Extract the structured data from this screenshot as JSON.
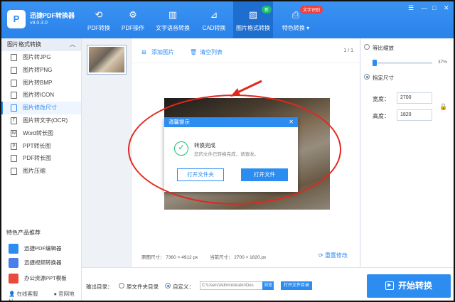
{
  "app": {
    "name": "迅捷PDF转换器",
    "version": "v9.0.3.0",
    "logo_glyph": "P"
  },
  "nav": [
    {
      "label": "PDF转换",
      "icon": "refresh-icon"
    },
    {
      "label": "PDF操作",
      "icon": "gear-icon"
    },
    {
      "label": "文字语音转换",
      "icon": "waveform-icon"
    },
    {
      "label": "CAD转换",
      "icon": "cad-icon"
    },
    {
      "label": "图片格式转换",
      "icon": "image-icon",
      "active": true,
      "badge": "新"
    },
    {
      "label": "特色转换 ▾",
      "icon": "special-icon",
      "badge": "文字识别"
    }
  ],
  "window_controls": {
    "settings": "☰",
    "minimize": "—",
    "maximize": "□",
    "close": "✕"
  },
  "sidebar": {
    "section": "图片格式转换",
    "items": [
      {
        "label": "图片转JPG"
      },
      {
        "label": "图片转PNG"
      },
      {
        "label": "图片转BMP"
      },
      {
        "label": "图片转ICON"
      },
      {
        "label": "图片修改尺寸",
        "active": true
      },
      {
        "label": "图片转文字(OCR)"
      },
      {
        "label": "Word转长图"
      },
      {
        "label": "PPT转长图"
      },
      {
        "label": "PDF转长图"
      },
      {
        "label": "图片压缩"
      }
    ],
    "featured_title": "特色产品推荐",
    "featured": [
      {
        "label": "迅捷PDF编辑器",
        "color": "#2d8cf0"
      },
      {
        "label": "迅捷视频转换器",
        "color": "#4a7ee8"
      },
      {
        "label": "办公资源PPT模板",
        "color": "#e84a3c"
      }
    ],
    "online_service": "在线客服",
    "website": "官网地址"
  },
  "toolbar": {
    "add_image": "添加图片",
    "clear_list": "清空列表",
    "page": "1 / 1"
  },
  "image_info": {
    "original_size": "原图尺寸：  7360 × 4912 px",
    "current_size": "当前尺寸：  2700 × 1820.px"
  },
  "reset_label": "重置修改",
  "right_panel": {
    "proportional_label": "等比缩放",
    "percent": "37%",
    "fixed_label": "指定尺寸",
    "width_label": "宽度：",
    "width_value": "2700",
    "height_label": "高度：",
    "height_value": "1820"
  },
  "bottom": {
    "output_label": "输出目录：",
    "source_dir": "原文件夹目录",
    "custom": "自定义：",
    "path": "C:\\Users\\Administrator\\Des",
    "browse": "浏览",
    "open_folder": "打开文件目录",
    "start": "开始转换"
  },
  "dialog": {
    "title": "温馨提示",
    "close": "✕",
    "heading": "转换完成",
    "message": "您的文件已转换完成，请查收。",
    "open_folder": "打开文件夹",
    "open_file": "打开文件"
  },
  "colors": {
    "accent": "#2d8cf0",
    "success": "#19be6b",
    "annotation": "#e0281e"
  }
}
